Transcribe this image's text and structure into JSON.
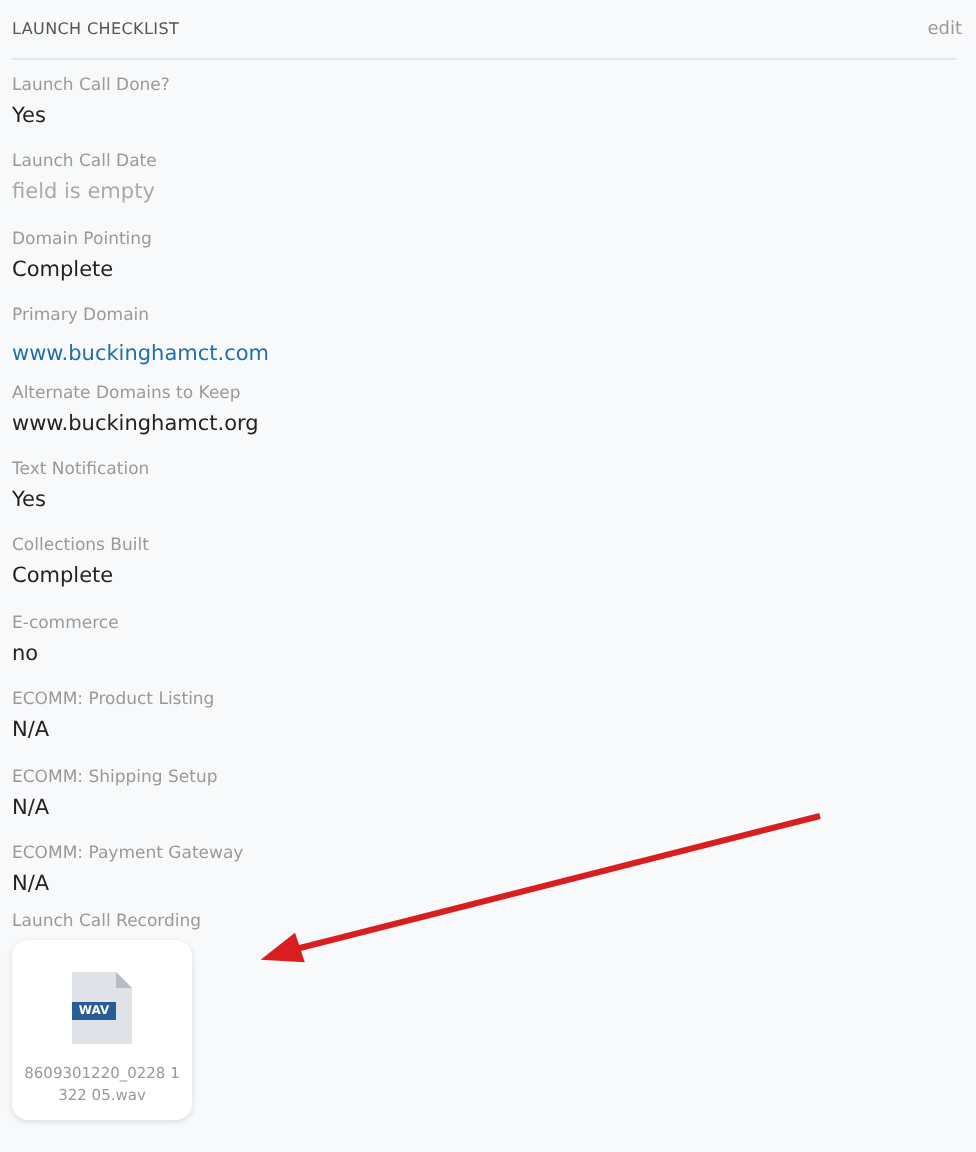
{
  "header": {
    "title": "LAUNCH CHECKLIST",
    "action": "edit"
  },
  "fields": [
    {
      "label": "Launch Call Done?",
      "value": "Yes",
      "kind": "text"
    },
    {
      "label": "Launch Call Date",
      "value": "field is empty",
      "kind": "empty"
    },
    {
      "label": "Domain Pointing",
      "value": "Complete",
      "kind": "text"
    },
    {
      "label": "Primary Domain",
      "value": "www.buckinghamct.com",
      "kind": "link"
    },
    {
      "label": "Alternate Domains to Keep",
      "value": "www.buckinghamct.org",
      "kind": "text"
    },
    {
      "label": "Text Notification",
      "value": "Yes",
      "kind": "text"
    },
    {
      "label": "Collections Built",
      "value": "Complete",
      "kind": "text"
    },
    {
      "label": "E-commerce",
      "value": "no",
      "kind": "text"
    },
    {
      "label": "ECOMM: Product Listing",
      "value": "N/A",
      "kind": "text"
    },
    {
      "label": "ECOMM: Shipping Setup",
      "value": "N/A",
      "kind": "text"
    },
    {
      "label": "ECOMM: Payment Gateway",
      "value": "N/A",
      "kind": "text"
    }
  ],
  "attachment": {
    "label": "Launch Call Recording",
    "badge": "WAV",
    "filename": "8609301220_0228 1322 05.wav"
  }
}
